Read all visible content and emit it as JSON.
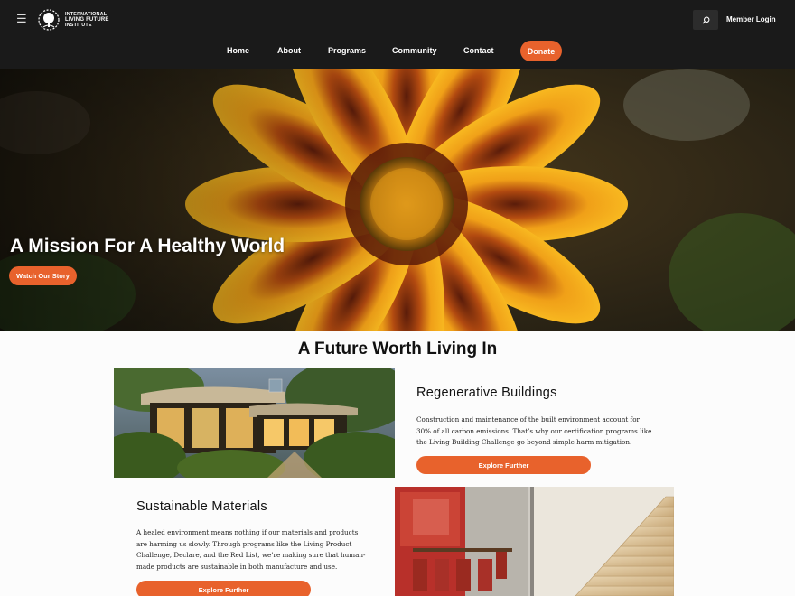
{
  "header": {
    "logo_lines": [
      "INTERNATIONAL",
      "LIVING FUTURE",
      "INSTITUTE"
    ],
    "member_login": "Member Login",
    "nav": [
      "Home",
      "About",
      "Programs",
      "Community",
      "Contact"
    ],
    "donate": "Donate"
  },
  "hero": {
    "title": "A Mission For A Healthy World",
    "button": "Watch Our Story"
  },
  "section": {
    "title": "A Future Worth Living In"
  },
  "cards": [
    {
      "title": "Regenerative Buildings",
      "text": "Construction and maintenance of the built environment account for 30% of all carbon emissions. That’s why our certification programs like the Living Building Challenge go beyond simple harm mitigation.",
      "button": "Explore Further"
    },
    {
      "title": "Sustainable Materials",
      "text": "A healed environment means nothing if our materials and products are harming us slowly. Through programs like the Living Product Challenge, Declare, and the Red List, we’re making sure that human-made products are sustainable in both manufacture and use.",
      "button": "Explore Further"
    }
  ],
  "colors": {
    "accent": "#e8622c",
    "header_bg": "#1a1a1a"
  },
  "icons": {
    "menu": "hamburger-icon",
    "search": "search-icon",
    "logo": "tree-logo-icon"
  }
}
